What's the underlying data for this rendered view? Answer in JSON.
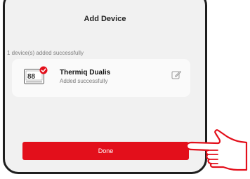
{
  "dialog": {
    "title": "Add Device",
    "status": "1 device(s) added successfully"
  },
  "device": {
    "name": "Thermiq Dualis",
    "status": "Added successfully",
    "icon": "thermostat-icon",
    "badge_icon": "checkmark-badge-icon"
  },
  "actions": {
    "done_label": "Done",
    "edit_icon": "edit-icon"
  },
  "colors": {
    "primary": "#e30f1b",
    "dialog_bg": "#f1f1f1",
    "card_bg": "#fafafa"
  }
}
